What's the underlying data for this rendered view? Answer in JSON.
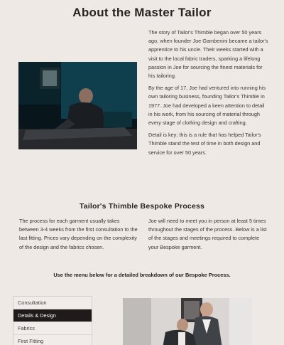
{
  "page": {
    "title": "About the Master Tailor"
  },
  "story": {
    "paragraphs": [
      "The story of Tailor's Thimble began over 50 years ago, when founder Joe Gambenini became a tailor's apprentice to his uncle. Their weeks started with a visit to the local fabric traders, sparking a lifelong passion in Joe for sourcing the finest materials for his tailoring.",
      "By the age of 17, Joe had ventured into running his own tailoring business, founding Tailor's Thimble in 1977. Joe had developed a keen attention to detail in his work, from his sourcing of material through every stage of clothing design and crafting.",
      "Detail is key; this is a rule that has helped Tailor's Thimble stand the test of time in both design and service for over 50 years."
    ]
  },
  "process": {
    "heading": "Tailor's Thimble Bespoke Process",
    "left_text": "The process for each garment usually takes between 3-4 weeks from the first consultation to the last fitting. Prices vary depending on the complexity of the design and the fabrics chosen.",
    "right_text": "Joe will need to meet you in person at least 5 times throughout the stages of the process. Below is a list of the stages and meetings required to complete your Bespoke garment.",
    "menu_hint": "Use the menu below for a detailed breakdown of our Bespoke Process.",
    "menu_items": [
      {
        "label": "Consultation",
        "active": false
      },
      {
        "label": "Details & Design",
        "active": true
      },
      {
        "label": "Fabrics",
        "active": false
      },
      {
        "label": "First Fitting",
        "active": false
      }
    ]
  },
  "colors": {
    "background": "#efe9e6",
    "active_menu": "#201a1a",
    "photo_teal": "#0f3f4c"
  }
}
